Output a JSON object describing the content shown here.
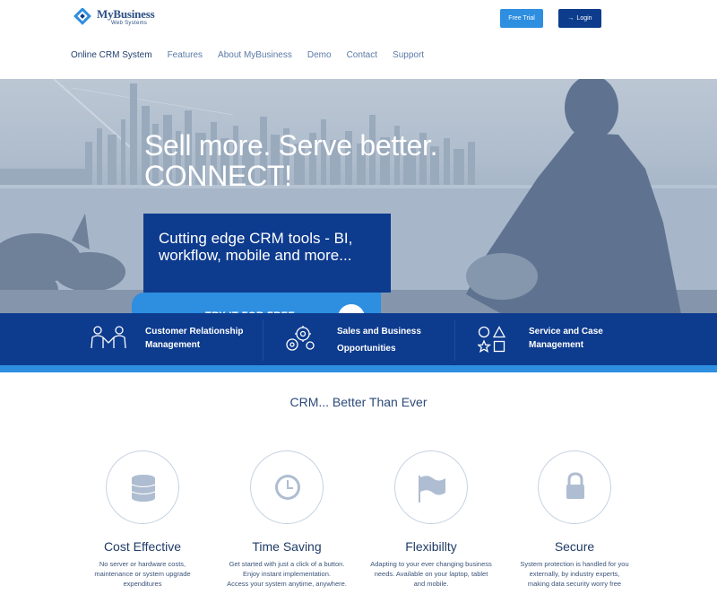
{
  "header": {
    "logo_name": "MyBusiness",
    "logo_sub": "Web Systems",
    "free_trial_label": "Free Trial",
    "login_label": "Login"
  },
  "nav": {
    "items": [
      {
        "label": "Online CRM System"
      },
      {
        "label": "Features"
      },
      {
        "label": "About MyBusiness"
      },
      {
        "label": "Demo"
      },
      {
        "label": "Contact"
      },
      {
        "label": "Support"
      }
    ]
  },
  "hero": {
    "title_line1": "Sell more. Serve better.",
    "title_line2": "CONNECT!",
    "callout_text": "Cutting edge CRM tools - BI, workflow, mobile and more...",
    "cta_label": "TRY IT FOR FREE"
  },
  "band": {
    "items": [
      {
        "line1": "Customer Relationship",
        "line2": "Management",
        "icon": "people-handshake-icon"
      },
      {
        "line1": "Sales and Business",
        "line2": "Opportunities",
        "icon": "gears-icon"
      },
      {
        "line1": "Service and Case",
        "line2": "Management",
        "icon": "shapes-icon"
      }
    ]
  },
  "section": {
    "title": "CRM... Better Than Ever"
  },
  "features": [
    {
      "title": "Cost Effective",
      "desc": [
        "No server or hardware costs,",
        "maintenance or system upgrade",
        "expenditures"
      ],
      "icon": "database-icon"
    },
    {
      "title": "Time Saving",
      "desc": [
        "Get started with just a click of a button.",
        "Enjoy instant implementation.",
        "Access your system anytime, anywhere."
      ],
      "icon": "clock-icon"
    },
    {
      "title": "Flexibillty",
      "desc": [
        "Adapting to your ever changing business",
        "needs. Available on your laptop, tablet",
        "and mobile."
      ],
      "icon": "flag-icon"
    },
    {
      "title": "Secure",
      "desc": [
        "System protection is handled for you",
        "externally, by industry experts,",
        "making data security worry free"
      ],
      "icon": "lock-icon"
    }
  ],
  "colors": {
    "primary": "#0d3b8e",
    "accent": "#2e8ee0",
    "text": "#1f3b66"
  }
}
